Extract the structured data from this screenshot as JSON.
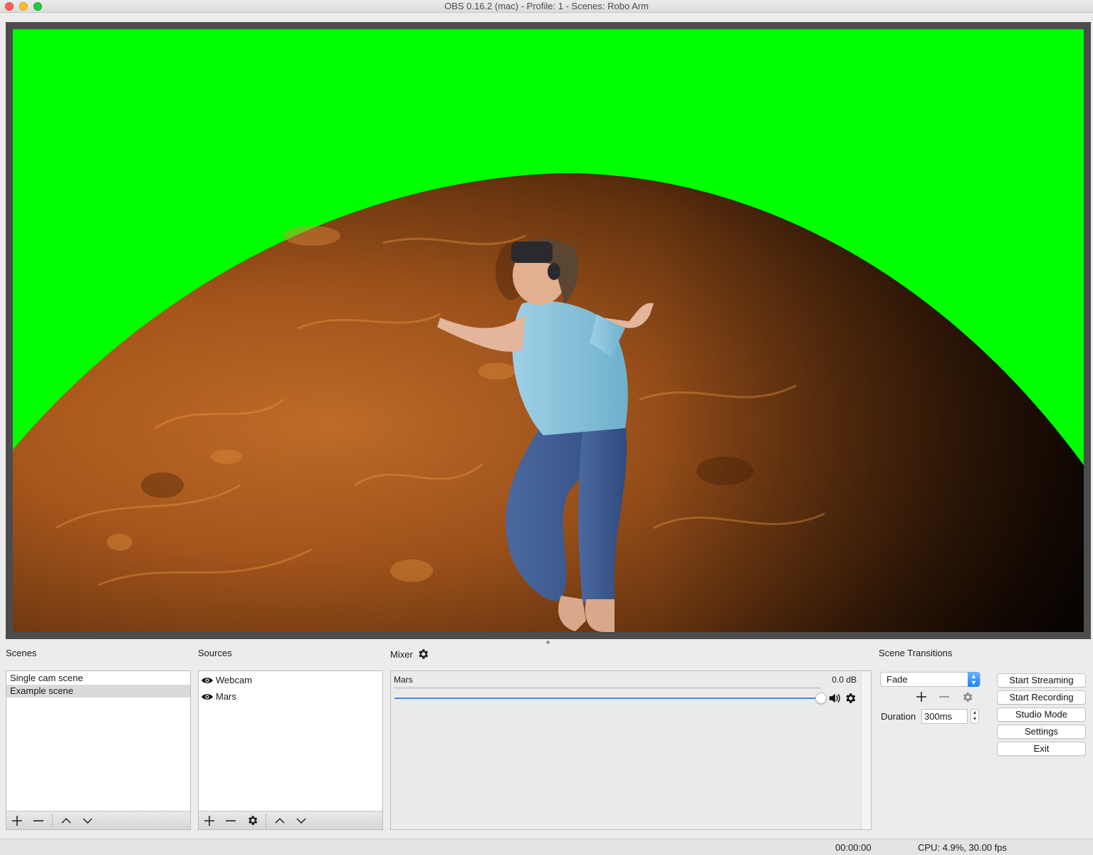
{
  "window": {
    "title": "OBS 0.16.2 (mac) - Profile: 1 - Scenes: Robo Arm"
  },
  "scenes": {
    "title": "Scenes",
    "items": [
      "Single cam scene",
      "Example scene"
    ],
    "selected": "Example scene"
  },
  "sources": {
    "title": "Sources",
    "items": [
      "Webcam",
      "Mars"
    ]
  },
  "mixer": {
    "title": "Mixer",
    "channel_name": "Mars",
    "channel_db": "0.0 dB",
    "volume_fraction": 1.0
  },
  "transitions": {
    "title": "Scene Transitions",
    "selected": "Fade",
    "duration_label": "Duration",
    "duration_value": "300ms"
  },
  "controls": {
    "start_streaming": "Start Streaming",
    "start_recording": "Start Recording",
    "studio_mode": "Studio Mode",
    "settings": "Settings",
    "exit": "Exit"
  },
  "status": {
    "time": "00:00:00",
    "cpu": "CPU: 4.9%, 30.00 fps"
  },
  "colors": {
    "chroma_green": "#00ff00",
    "accent_blue": "#3d8bf2"
  }
}
